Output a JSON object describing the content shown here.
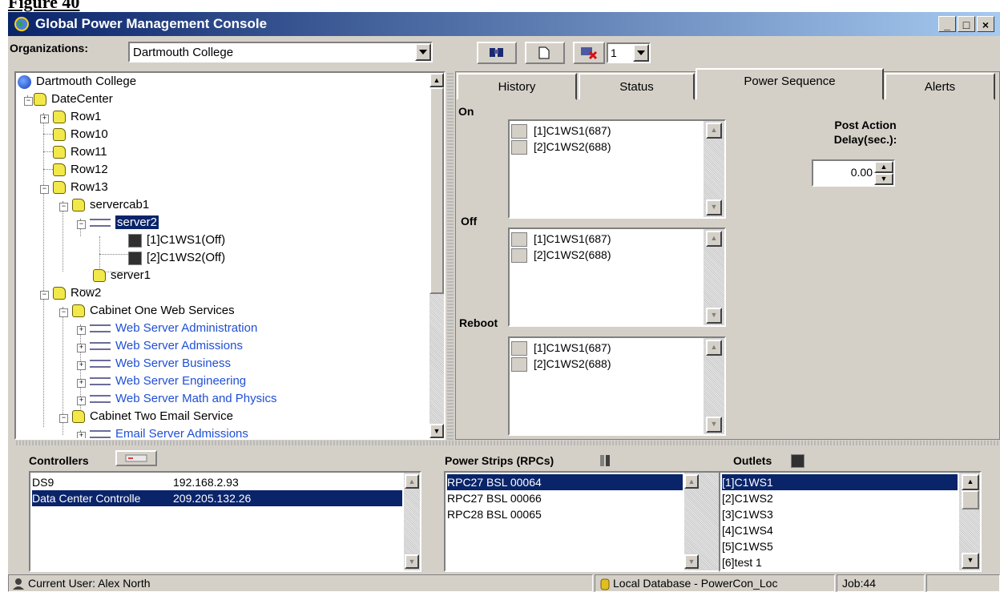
{
  "caption": "Figure 40",
  "window": {
    "title": "Global Power Management Console",
    "minimize": "_",
    "maximize": "□",
    "close": "×"
  },
  "org": {
    "label": "Organizations:",
    "value": "Dartmouth College"
  },
  "toolbar": {
    "page_value": "1"
  },
  "tree": {
    "root": "Dartmouth College",
    "datecenter": "DateCenter",
    "row1": "Row1",
    "row10": "Row10",
    "row11": "Row11",
    "row12": "Row12",
    "row13": "Row13",
    "servercab1": "servercab1",
    "server2": "server2",
    "outlet1": "[1]C1WS1(Off)",
    "outlet2": "[2]C1WS2(Off)",
    "server1": "server1",
    "row2": "Row2",
    "cab1": "Cabinet One Web Services",
    "ws_admin": "Web Server Administration",
    "ws_admissions": "Web Server Admissions",
    "ws_business": "Web Server Business",
    "ws_engineering": "Web Server Engineering",
    "ws_math": "Web Server Math and Physics",
    "cab2": "Cabinet Two Email Service",
    "email_admissions": "Email Server Admissions"
  },
  "tabs": [
    "History",
    "Status",
    "Power Sequence",
    "Alerts"
  ],
  "power_sequence": {
    "on_label": "On",
    "off_label": "Off",
    "reboot_label": "Reboot",
    "items": [
      "[1]C1WS1(687)",
      "[2]C1WS2(688)"
    ],
    "delay_label_1": "Post Action",
    "delay_label_2": "Delay(sec.):",
    "delay_value": "0.00"
  },
  "controllers": {
    "label": "Controllers",
    "rows": [
      {
        "name": "DS9",
        "ip": "192.168.2.93"
      },
      {
        "name": "Data Center Controlle",
        "ip": "209.205.132.26"
      }
    ]
  },
  "power_strips": {
    "label": "Power Strips (RPCs)",
    "items": [
      "RPC27 BSL 00064",
      "RPC27 BSL 00066",
      "RPC28 BSL 00065"
    ]
  },
  "outlets": {
    "label": "Outlets",
    "items": [
      "[1]C1WS1",
      "[2]C1WS2",
      "[3]C1WS3",
      "[4]C1WS4",
      "[5]C1WS5",
      "[6]test 1"
    ]
  },
  "status": {
    "user": "Current User: Alex North",
    "database": "Local Database - PowerCon_Loc",
    "job": "Job:44"
  }
}
